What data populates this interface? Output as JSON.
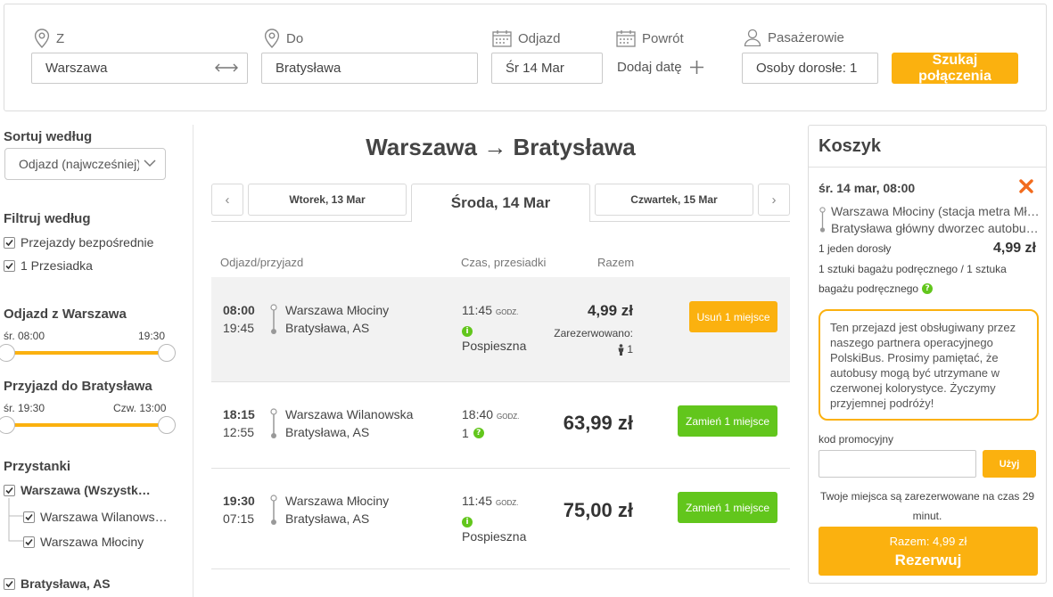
{
  "search": {
    "from_label": "Z",
    "from_value": "Warszawa",
    "to_label": "Do",
    "to_value": "Bratysława",
    "departure_label": "Odjazd",
    "departure_value": "Śr 14 Mar",
    "return_label": "Powrót",
    "return_add": "Dodaj datę",
    "passengers_label": "Pasażerowie",
    "passengers_value": "Osoby dorosłe: 1",
    "search_button": "Szukaj połączenia"
  },
  "sidebar": {
    "sort_title": "Sortuj według",
    "sort_value": "Odjazd (najwcześniej)",
    "filter_title": "Filtruj według",
    "filter_direct": "Przejazdy bezpośrednie",
    "filter_one_change": "1 Przesiadka",
    "departure_title": "Odjazd z Warszawa",
    "departure_min": "śr. 08:00",
    "departure_max": "19:30",
    "arrival_title": "Przyjazd do Bratysława",
    "arrival_min": "śr. 19:30",
    "arrival_max": "Czw. 13:00",
    "stops_title": "Przystanki",
    "stop_group_1": "Warszawa (Wszystk…",
    "stop_1a": "Warszawa Wilanows…",
    "stop_1b": "Warszawa Młociny",
    "stop_group_2": "Bratysława, AS"
  },
  "main": {
    "title_from": "Warszawa",
    "title_arrow": "→",
    "title_to": "Bratysława",
    "prev_arrow": "‹",
    "next_arrow": "›",
    "day_prev": "Wtorek, 13 Mar",
    "day_active": "Środa, 14 Mar",
    "day_next": "Czwartek, 15 Mar",
    "col_departure": "Odjazd/przyjazd",
    "col_duration": "Czas, przesiadki",
    "col_total": "Razem",
    "rows": [
      {
        "dep_time": "08:00",
        "arr_time": "19:45",
        "from": "Warszawa Młociny",
        "to": "Bratysława, AS",
        "duration": "11:45",
        "duration_unit": "GODZ.",
        "transfer": "Pospieszna",
        "price": "4,99 zł",
        "reserved_label": "Zarezerwowano:",
        "reserved_count": "1",
        "button": "Usuń 1 miejsce"
      },
      {
        "dep_time": "18:15",
        "arr_time": "12:55",
        "from": "Warszawa Wilanowska",
        "to": "Bratysława, AS",
        "duration": "18:40",
        "duration_unit": "GODZ.",
        "transfer": "1",
        "price": "63,99 zł",
        "button": "Zamień 1 miejsce"
      },
      {
        "dep_time": "19:30",
        "arr_time": "07:15",
        "from": "Warszawa Młociny",
        "to": "Bratysława, AS",
        "duration": "11:45",
        "duration_unit": "GODZ.",
        "transfer": "Pospieszna",
        "price": "75,00 zł",
        "button": "Zamień 1 miejsce"
      }
    ]
  },
  "cart": {
    "title": "Koszyk",
    "trip_date": "śr. 14 mar, 08:00",
    "stop_from": "Warszawa Młociny (stacja metra Mł…",
    "stop_to": "Bratysława główny dworzec autobu…",
    "passenger": "1 jeden dorosły",
    "price": "4,99 zł",
    "luggage_1": "1 sztuki bagażu podręcznego / 1 sztuka",
    "luggage_2": "bagażu podręcznego",
    "notice": "Ten przejazd jest obsługiwany przez naszego partnera operacyjnego PolskiBus. Prosimy pamiętać, że autobusy mogą być utrzymane w czerwonej kolorystyce. Życzymy przyjemnej podróży!",
    "promo_label": "kod promocyjny",
    "promo_button": "Użyj",
    "reserved_note_1": "Twoje miejsca są zarezerwowane na czas 29",
    "reserved_note_2": "minut.",
    "total_label": "Razem: 4,99 zł",
    "reserve_button": "Rezerwuj"
  },
  "colors": {
    "accent": "#fbb10f",
    "green": "#62c61c",
    "remove": "#f26b1d"
  }
}
